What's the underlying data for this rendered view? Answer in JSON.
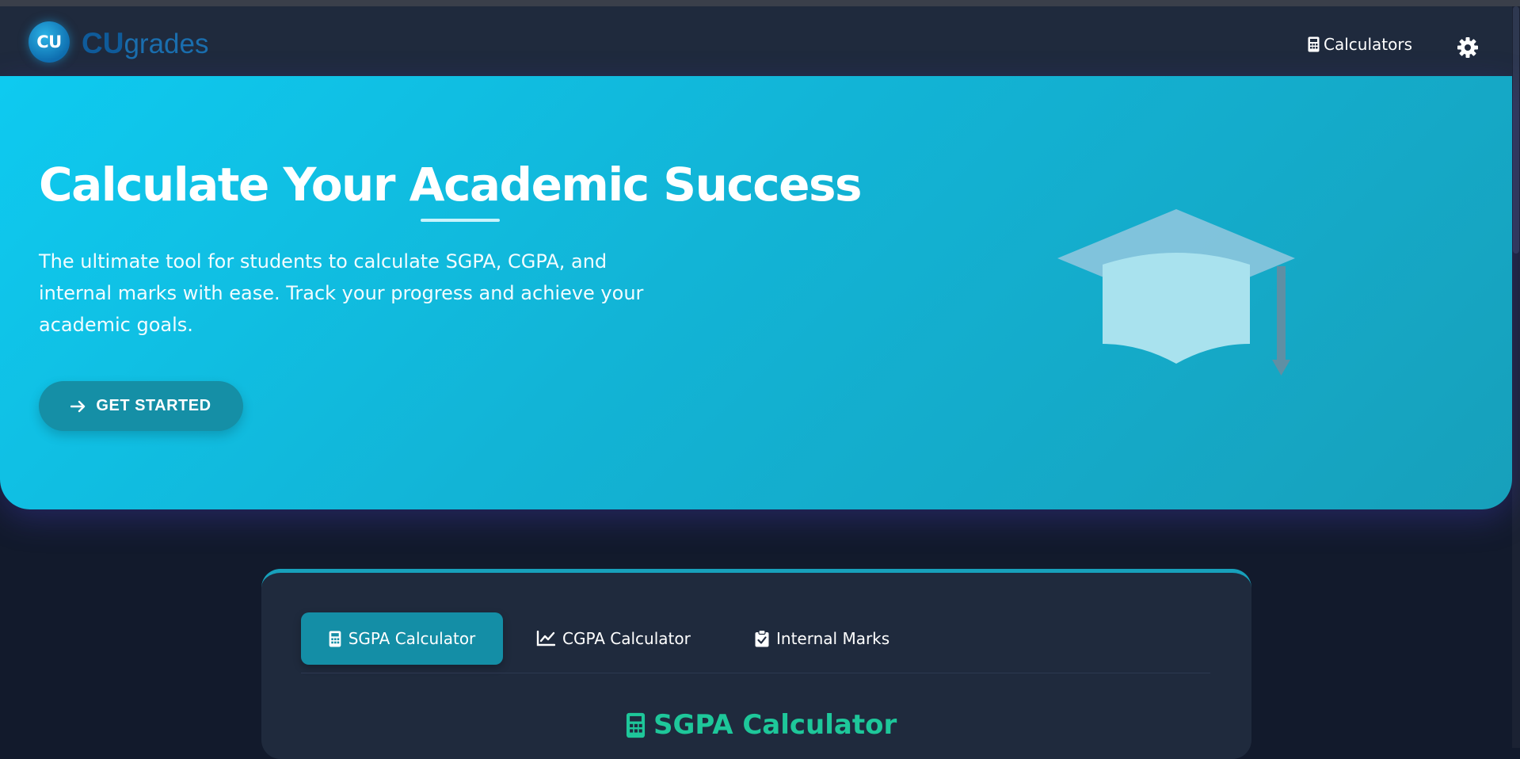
{
  "brand": {
    "badge": "CU",
    "name_strong": "CU",
    "name_light": "grades"
  },
  "nav": {
    "calculators_label": "Calculators",
    "settings_icon": "gear-icon",
    "calculators_icon": "calculator-icon"
  },
  "hero": {
    "title": "Calculate Your Academic Success",
    "description": "The ultimate tool for students to calculate SGPA, CGPA, and internal marks with ease. Track your progress and achieve your academic goals.",
    "cta_label": "GET STARTED",
    "cta_icon": "arrow-right-icon",
    "illustration_icon": "graduation-cap-icon"
  },
  "tabs": [
    {
      "label": "SGPA Calculator",
      "icon": "calculator-icon",
      "active": true
    },
    {
      "label": "CGPA Calculator",
      "icon": "chart-line-icon",
      "active": false
    },
    {
      "label": "Internal Marks",
      "icon": "clipboard-check-icon",
      "active": false
    }
  ],
  "section": {
    "title": "SGPA Calculator",
    "icon": "calculator-icon"
  },
  "colors": {
    "navbar": "#1f2a3d",
    "page_bg": "#121a2c",
    "hero_from": "#0ecaf0",
    "hero_to": "#17a0bb",
    "accent": "#148ea6",
    "section_title": "#1ec79a"
  }
}
